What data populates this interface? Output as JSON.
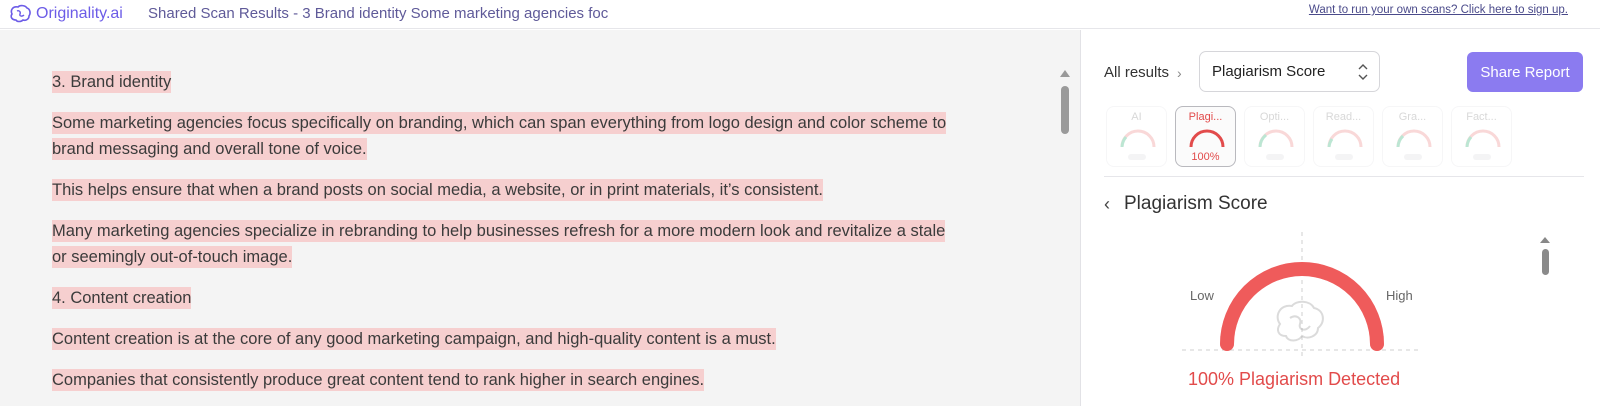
{
  "header": {
    "logo_text": "Originality.ai",
    "scan_title": "Shared Scan Results - 3 Brand identity Some marketing agencies foc",
    "signup_link": "Want to run your own scans? Click here to sign up."
  },
  "document": {
    "paragraphs": [
      "3. Brand identity",
      "Some marketing agencies focus specifically on branding, which can span everything from logo design and color scheme to brand messaging and overall tone of voice.",
      "This helps ensure that when a brand posts on social media, a website, or in print materials, it’s consistent.",
      "Many marketing agencies specialize in rebranding to help businesses refresh for a more modern look and revitalize a stale or seemingly out-of-touch image.",
      "4. Content creation",
      "Content creation is at the core of any good marketing campaign, and high-quality content is a must.",
      "Companies that consistently produce great content tend to rank higher in search engines."
    ]
  },
  "sidebar": {
    "breadcrumb_all": "All results",
    "select_value": "Plagiarism Score",
    "share_button": "Share Report",
    "cards": [
      {
        "label": "AI",
        "value": ""
      },
      {
        "label": "Plagi...",
        "value": "100%"
      },
      {
        "label": "Opti...",
        "value": ""
      },
      {
        "label": "Read...",
        "value": ""
      },
      {
        "label": "Gra...",
        "value": ""
      },
      {
        "label": "Fact...",
        "value": ""
      }
    ],
    "section_title": "Plagiarism Score",
    "gauge": {
      "low_label": "Low",
      "high_label": "High",
      "level": 1.0,
      "result_text": "100% Plagiarism Detected"
    }
  },
  "colors": {
    "brand": "#6c5ce7",
    "accent_button": "#8b7bf0",
    "highlight": "#f6cfcf",
    "danger": "#e24b4b"
  }
}
